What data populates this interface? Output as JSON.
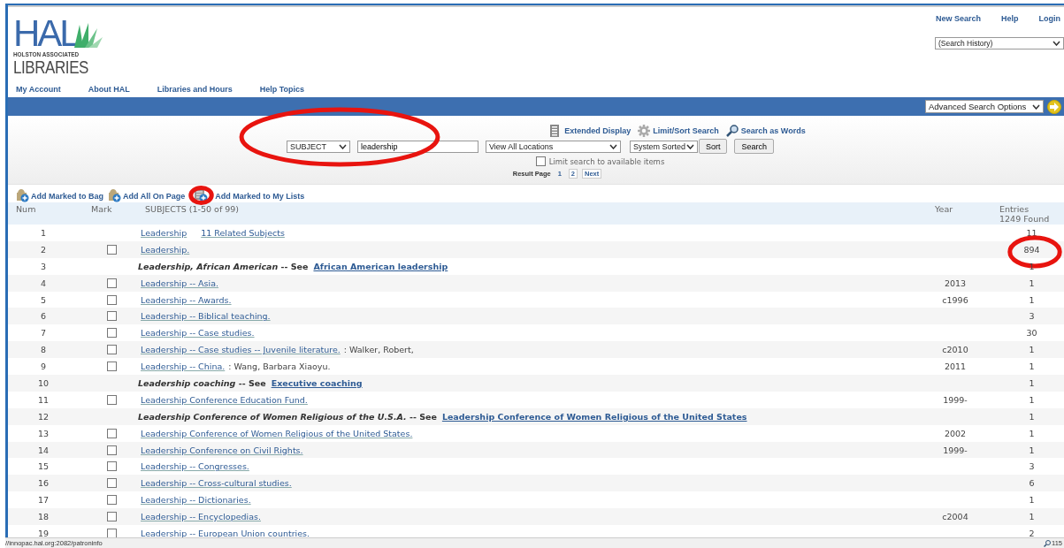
{
  "logo": {
    "mark": "HAL",
    "line1": "HOLSTON ASSOCIATED",
    "line2": "LIBRARIES"
  },
  "top_links": [
    "New Search",
    "Help",
    "Login"
  ],
  "search_history": {
    "value": "(Search History)"
  },
  "nav": [
    "My Account",
    "About HAL",
    "Libraries and Hours",
    "Help Topics"
  ],
  "advanced_options": {
    "value": "Advanced Search Options"
  },
  "search": {
    "circled": true,
    "options": [
      {
        "kind": "display",
        "label": "Extended Display"
      },
      {
        "kind": "limit",
        "label": "Limit/Sort Search"
      },
      {
        "kind": "words",
        "label": "Search as Words"
      }
    ],
    "index": "SUBJECT",
    "query": "leadership",
    "location": "View All Locations",
    "sort_order": "System Sorted",
    "buttons": [
      "Sort",
      "Search"
    ],
    "limit_checkbox": {
      "label": "Limit search to available items",
      "checked": false
    },
    "result_page": {
      "label": "Result Page",
      "pages": [
        {
          "label": "1",
          "selected": true
        },
        {
          "label": "2",
          "selected": false
        },
        {
          "label": "Next",
          "selected": false
        }
      ]
    }
  },
  "toolbar": [
    {
      "kind": "bag",
      "label": "Add Marked to Bag",
      "circled": false
    },
    {
      "kind": "bag",
      "label": "Add All On Page",
      "circled": false
    },
    {
      "kind": "list",
      "label": "Add Marked to My Lists",
      "circled": true
    }
  ],
  "table": {
    "columns": [
      "Num",
      "Mark",
      "SUBJECTS (1-50 of 99)",
      "Year"
    ],
    "entries_header": [
      "Entries",
      "1249 Found"
    ],
    "rows": [
      {
        "num": "1",
        "kind": "related",
        "heading": "Leadership",
        "link": "11 Related Subjects",
        "entries": "11",
        "circled": false
      },
      {
        "num": "2",
        "kind": "entry",
        "heading": "Leadership.",
        "checked": false,
        "entries": "894",
        "circled": true
      },
      {
        "num": "3",
        "kind": "see",
        "heading": "*Leadership, African American* -- See",
        "link": "African American leadership",
        "entries": "1",
        "circled": false
      },
      {
        "num": "4",
        "kind": "entry",
        "heading": "Leadership -- Asia.",
        "checked": false,
        "year": "2013",
        "entries": "1",
        "circled": false
      },
      {
        "num": "5",
        "kind": "entry",
        "heading": "Leadership -- Awards.",
        "checked": false,
        "year": "c1996",
        "entries": "1",
        "circled": false
      },
      {
        "num": "6",
        "kind": "entry",
        "heading": "Leadership -- Biblical teaching.",
        "checked": false,
        "entries": "3",
        "circled": false
      },
      {
        "num": "7",
        "kind": "entry",
        "heading": "Leadership -- Case studies.",
        "checked": false,
        "entries": "30",
        "circled": false
      },
      {
        "num": "8",
        "kind": "entry",
        "heading": "Leadership -- Case studies -- Juvenile literature.",
        "author": ": Walker, Robert,",
        "checked": false,
        "year": "c2010",
        "entries": "1",
        "circled": false
      },
      {
        "num": "9",
        "kind": "entry",
        "heading": "Leadership -- China.",
        "author": ": Wang, Barbara Xiaoyu.",
        "checked": false,
        "year": "2011",
        "entries": "1",
        "circled": false
      },
      {
        "num": "10",
        "kind": "see",
        "heading": "*Leadership coaching* -- See",
        "link": "Executive coaching",
        "entries": "1",
        "circled": false
      },
      {
        "num": "11",
        "kind": "entry",
        "heading": "Leadership Conference Education Fund.",
        "checked": false,
        "year": "1999-",
        "entries": "1",
        "circled": false
      },
      {
        "num": "12",
        "kind": "see",
        "heading": "*Leadership Conference of Women Religious of the U.S.A.* -- See",
        "link": "Leadership Conference of Women Religious of the United States",
        "entries": "1",
        "circled": false
      },
      {
        "num": "13",
        "kind": "entry",
        "heading": "Leadership Conference of Women Religious of the United States.",
        "checked": false,
        "year": "2002",
        "entries": "1",
        "circled": false
      },
      {
        "num": "14",
        "kind": "entry",
        "heading": "Leadership Conference on Civil Rights.",
        "checked": false,
        "year": "1999-",
        "entries": "1",
        "circled": false
      },
      {
        "num": "15",
        "kind": "entry",
        "heading": "Leadership -- Congresses.",
        "checked": false,
        "entries": "3",
        "circled": false
      },
      {
        "num": "16",
        "kind": "entry",
        "heading": "Leadership -- Cross-cultural studies.",
        "checked": false,
        "entries": "6",
        "circled": false
      },
      {
        "num": "17",
        "kind": "entry",
        "heading": "Leadership -- Dictionaries.",
        "checked": false,
        "entries": "1",
        "circled": false
      },
      {
        "num": "18",
        "kind": "entry",
        "heading": "Leadership -- Encyclopedias.",
        "checked": false,
        "year": "c2004",
        "entries": "1",
        "circled": false
      },
      {
        "num": "19",
        "kind": "entry",
        "heading": "Leadership -- European Union countries.",
        "checked": false,
        "entries": "2",
        "circled": false
      }
    ]
  },
  "status_bar": {
    "url": "//innopac.hal.org:2082/patroninfo",
    "zoom": "115"
  }
}
